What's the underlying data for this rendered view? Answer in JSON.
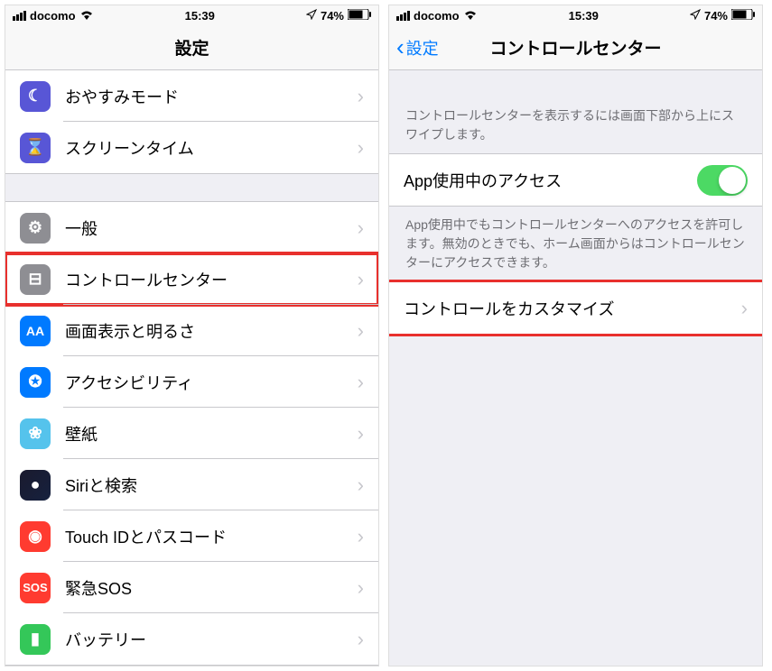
{
  "status": {
    "carrier": "docomo",
    "time": "15:39",
    "battery": "74%"
  },
  "left": {
    "title": "設定",
    "groups": [
      {
        "rows": [
          {
            "id": "dnd",
            "label": "おやすみモード",
            "icon": "ic-dnd",
            "glyph": "☾"
          },
          {
            "id": "screentime",
            "label": "スクリーンタイム",
            "icon": "ic-screentime",
            "glyph": "⌛"
          }
        ]
      },
      {
        "rows": [
          {
            "id": "general",
            "label": "一般",
            "icon": "ic-general",
            "glyph": "⚙"
          },
          {
            "id": "control-center",
            "label": "コントロールセンター",
            "icon": "ic-control",
            "glyph": "⊟",
            "highlight": true
          },
          {
            "id": "display",
            "label": "画面表示と明るさ",
            "icon": "ic-display",
            "glyph": "AA"
          },
          {
            "id": "accessibility",
            "label": "アクセシビリティ",
            "icon": "ic-accessibility",
            "glyph": "✪"
          },
          {
            "id": "wallpaper",
            "label": "壁紙",
            "icon": "ic-wallpaper",
            "glyph": "❀"
          },
          {
            "id": "siri",
            "label": "Siriと検索",
            "icon": "ic-siri",
            "glyph": "●"
          },
          {
            "id": "touchid",
            "label": "Touch IDとパスコード",
            "icon": "ic-touchid",
            "glyph": "◉"
          },
          {
            "id": "sos",
            "label": "緊急SOS",
            "icon": "ic-sos",
            "glyph": "SOS"
          },
          {
            "id": "battery",
            "label": "バッテリー",
            "icon": "ic-battery",
            "glyph": "▮"
          }
        ]
      }
    ]
  },
  "right": {
    "back": "設定",
    "title": "コントロールセンター",
    "hint1": "コントロールセンターを表示するには画面下部から上にスワイプします。",
    "access_label": "App使用中のアクセス",
    "access_on": true,
    "hint2": "App使用中でもコントロールセンターへのアクセスを許可します。無効のときでも、ホーム画面からはコントロールセンターにアクセスできます。",
    "customize_label": "コントロールをカスタマイズ",
    "customize_highlight": true
  }
}
